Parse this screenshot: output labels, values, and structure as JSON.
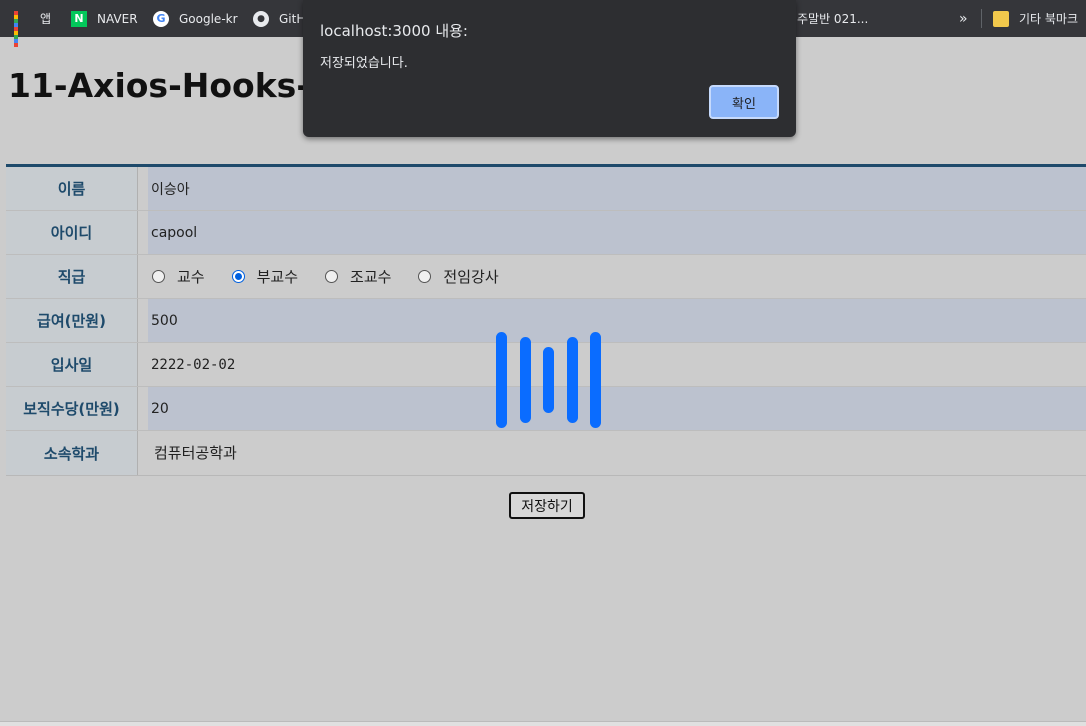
{
  "bookmarks": {
    "items": [
      {
        "label": "앱",
        "icon": "apps-grid-icon"
      },
      {
        "label": "NAVER",
        "icon": "naver-icon"
      },
      {
        "label": "Google-kr",
        "icon": "google-icon"
      },
      {
        "label": "GitH",
        "icon": "github-icon"
      },
      {
        "label": "주말반 021...",
        "icon": ""
      },
      {
        "label": "기타 북마크",
        "icon": "folder-icon"
      }
    ],
    "overflow": "»"
  },
  "page": {
    "title": "11-Axios-Hooks-C"
  },
  "form": {
    "name_label": "이름",
    "name_value": "이승아",
    "id_label": "아이디",
    "id_value": "capool",
    "position_label": "직급",
    "position_options": [
      "교수",
      "부교수",
      "조교수",
      "전임강사"
    ],
    "position_selected": "부교수",
    "salary_label": "급여(만원)",
    "salary_value": "500",
    "hiredate_label": "입사일",
    "hiredate_value": "2222-02-02",
    "bonus_label": "보직수당(만원)",
    "bonus_value": "20",
    "dept_label": "소속학과",
    "dept_value": "컴퓨터공학과",
    "save_label": "저장하기"
  },
  "alert": {
    "title": "localhost:3000 내용:",
    "message": "저장되었습니다.",
    "ok_label": "확인"
  },
  "colors": {
    "accent": "#1e4a6b",
    "spinner": "#0a6cff",
    "dialog_bg": "#2d2e31",
    "dialog_button": "#8ab4f8"
  }
}
